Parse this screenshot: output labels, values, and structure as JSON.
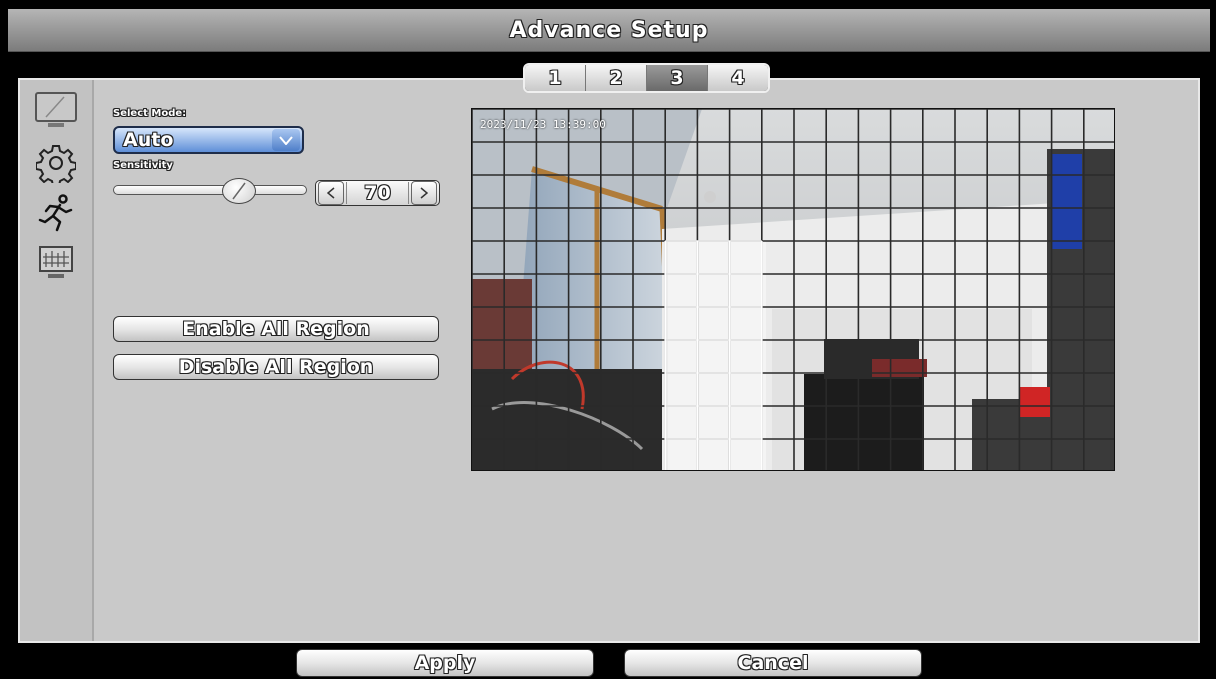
{
  "title": "Advance Setup",
  "tabs": [
    "1",
    "2",
    "3",
    "4"
  ],
  "active_tab": "3",
  "sidebar": [
    {
      "icon": "monitor-icon"
    },
    {
      "icon": "gear-icon"
    },
    {
      "icon": "motion-running-icon"
    },
    {
      "icon": "network-grid-icon"
    }
  ],
  "mode": {
    "label": "Select Mode:",
    "value": "Auto"
  },
  "sensitivity": {
    "label": "Sensitivity",
    "value": "70",
    "level_percent": 70
  },
  "buttons": {
    "enable_all": "Enable All Region",
    "disable_all": "Disable All Region",
    "apply": "Apply",
    "cancel": "Cancel"
  },
  "camera": {
    "timestamp": "2023/11/23 13:39:00",
    "grid": {
      "columns": 20,
      "rows": 11
    }
  }
}
